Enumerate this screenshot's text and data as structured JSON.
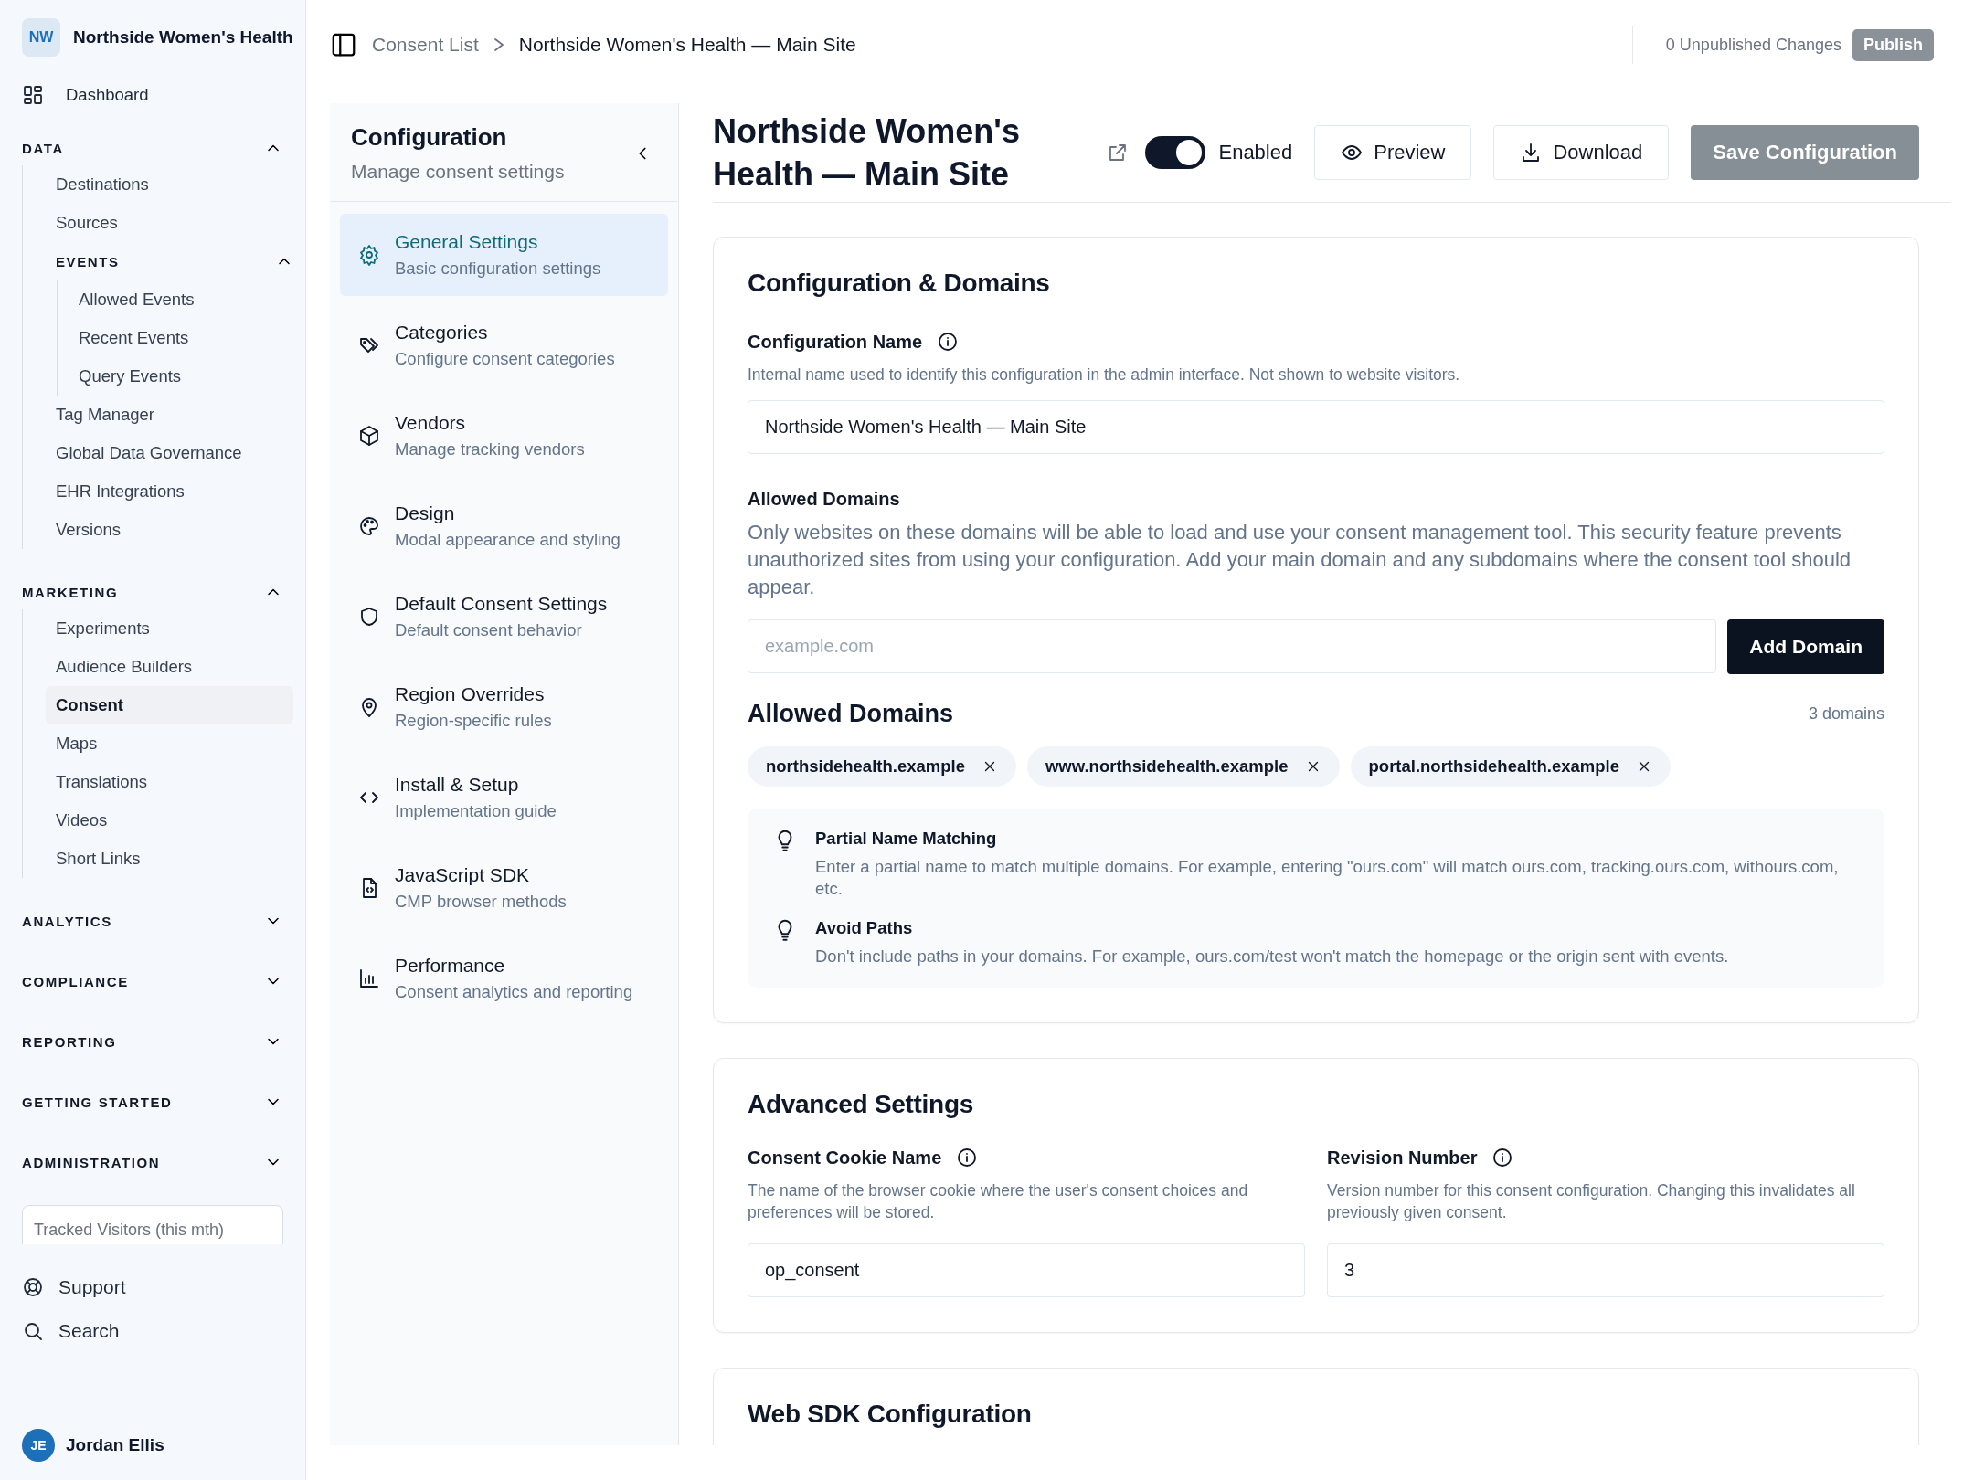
{
  "sidebar": {
    "org": {
      "initials": "NW",
      "name": "Northside Women's Health"
    },
    "dashboard": {
      "label": "Dashboard"
    },
    "sections": [
      {
        "title": "DATA",
        "expanded": true,
        "items": [
          {
            "kind": "link",
            "label": "Destinations",
            "selected": false
          },
          {
            "kind": "link",
            "label": "Sources",
            "selected": false
          },
          {
            "kind": "group",
            "label": "EVENTS",
            "expanded": true,
            "children": [
              {
                "kind": "link",
                "label": "Allowed Events",
                "selected": false
              },
              {
                "kind": "link",
                "label": "Recent Events",
                "selected": false
              },
              {
                "kind": "link",
                "label": "Query Events",
                "selected": false
              }
            ]
          },
          {
            "kind": "link",
            "label": "Tag Manager",
            "selected": false
          },
          {
            "kind": "link",
            "label": "Global Data Governance",
            "selected": false
          },
          {
            "kind": "link",
            "label": "EHR Integrations",
            "selected": false
          },
          {
            "kind": "link",
            "label": "Versions",
            "selected": false
          }
        ]
      },
      {
        "title": "MARKETING",
        "expanded": true,
        "items": [
          {
            "kind": "link",
            "label": "Experiments",
            "selected": false
          },
          {
            "kind": "link",
            "label": "Audience Builders",
            "selected": false
          },
          {
            "kind": "link",
            "label": "Consent",
            "selected": true
          },
          {
            "kind": "link",
            "label": "Maps",
            "selected": false
          },
          {
            "kind": "link",
            "label": "Translations",
            "selected": false
          },
          {
            "kind": "link",
            "label": "Videos",
            "selected": false
          },
          {
            "kind": "link",
            "label": "Short Links",
            "selected": false
          }
        ]
      },
      {
        "title": "ANALYTICS",
        "expanded": false
      },
      {
        "title": "COMPLIANCE",
        "expanded": false
      },
      {
        "title": "REPORTING",
        "expanded": false
      },
      {
        "title": "GETTING STARTED",
        "expanded": false
      },
      {
        "title": "ADMINISTRATION",
        "expanded": false
      }
    ],
    "usage_card": {
      "label": "Tracked Visitors (this mth)"
    },
    "footer_links": [
      {
        "label": "Support"
      },
      {
        "label": "Search"
      }
    ],
    "user": {
      "initials": "JE",
      "name": "Jordan Ellis"
    }
  },
  "topbar": {
    "breadcrumbs": [
      {
        "label": "Consent List"
      },
      {
        "label": "Northside Women's Health — Main Site"
      }
    ],
    "unpublished": "0 Unpublished Changes",
    "publish_button": {
      "label": "Publish",
      "disabled": true
    }
  },
  "config_nav": {
    "title": "Configuration",
    "subtitle": "Manage consent settings",
    "items": [
      {
        "label": "General Settings",
        "description": "Basic configuration settings",
        "selected": true
      },
      {
        "label": "Categories",
        "description": "Configure consent categories",
        "selected": false
      },
      {
        "label": "Vendors",
        "description": "Manage tracking vendors",
        "selected": false
      },
      {
        "label": "Design",
        "description": "Modal appearance and styling",
        "selected": false
      },
      {
        "label": "Default Consent Settings",
        "description": "Default consent behavior",
        "selected": false
      },
      {
        "label": "Region Overrides",
        "description": "Region-specific rules",
        "selected": false
      },
      {
        "label": "Install & Setup",
        "description": "Implementation guide",
        "selected": false
      },
      {
        "label": "JavaScript SDK",
        "description": "CMP browser methods",
        "selected": false
      },
      {
        "label": "Performance",
        "description": "Consent analytics and reporting",
        "selected": false
      }
    ]
  },
  "header": {
    "title": "Northside Women's Health — Main Site",
    "enabled": {
      "label": "Enabled",
      "on": true
    },
    "buttons": [
      {
        "label": "Preview"
      },
      {
        "label": "Download"
      }
    ],
    "save_button": {
      "label": "Save Configuration",
      "disabled": true
    }
  },
  "domains_card": {
    "title": "Configuration & Domains",
    "name_field": {
      "label": "Configuration Name",
      "hint": "Internal name used to identify this configuration in the admin interface. Not shown to website visitors.",
      "value": "Northside Women's Health — Main Site"
    },
    "allowed": {
      "label": "Allowed Domains",
      "description": "Only websites on these domains will be able to load and use your consent management tool. This security feature prevents unauthorized sites from using your configuration. Add your main domain and any subdomains where the consent tool should appear.",
      "placeholder": "example.com",
      "add_button": "Add Domain"
    },
    "list_title": "Allowed Domains",
    "count": "3 domains",
    "domains": [
      {
        "label": "northsidehealth.example"
      },
      {
        "label": "www.northsidehealth.example"
      },
      {
        "label": "portal.northsidehealth.example"
      }
    ],
    "tips": [
      {
        "title": "Partial Name Matching",
        "text": "Enter a partial name to match multiple domains. For example, entering \"ours.com\" will match ours.com, tracking.ours.com, withours.com, etc."
      },
      {
        "title": "Avoid Paths",
        "text": "Don't include paths in your domains. For example, ours.com/test won't match the homepage or the origin sent with events."
      }
    ]
  },
  "advanced_card": {
    "title": "Advanced Settings",
    "fields": [
      {
        "label": "Consent Cookie Name",
        "hint": "The name of the browser cookie where the user's consent choices and preferences will be stored.",
        "value": "op_consent"
      },
      {
        "label": "Revision Number",
        "hint": "Version number for this consent configuration. Changing this invalidates all previously given consent.",
        "value": "3"
      }
    ]
  },
  "sdk_card": {
    "title": "Web SDK Configuration"
  }
}
